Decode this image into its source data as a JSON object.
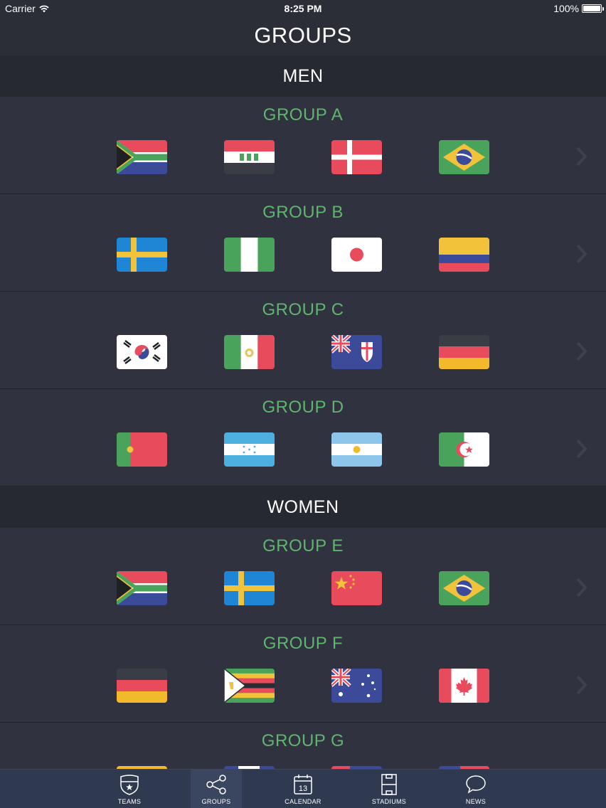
{
  "status_bar": {
    "carrier": "Carrier",
    "time": "8:25 PM",
    "battery": "100%"
  },
  "nav": {
    "title": "GROUPS"
  },
  "sections": [
    {
      "title": "MEN",
      "groups": [
        {
          "name": "GROUP A",
          "flags": [
            "south-africa-flag",
            "iraq-flag",
            "denmark-flag",
            "brazil-flag"
          ]
        },
        {
          "name": "GROUP B",
          "flags": [
            "sweden-flag",
            "nigeria-flag",
            "japan-flag",
            "colombia-flag"
          ]
        },
        {
          "name": "GROUP C",
          "flags": [
            "south-korea-flag",
            "mexico-flag",
            "fiji-flag",
            "germany-flag"
          ]
        },
        {
          "name": "GROUP D",
          "flags": [
            "portugal-flag",
            "honduras-flag",
            "argentina-flag",
            "algeria-flag"
          ]
        }
      ]
    },
    {
      "title": "WOMEN",
      "groups": [
        {
          "name": "GROUP E",
          "flags": [
            "south-africa-flag",
            "sweden-flag",
            "china-flag",
            "brazil-flag"
          ]
        },
        {
          "name": "GROUP F",
          "flags": [
            "germany-flag",
            "zimbabwe-flag",
            "australia-flag",
            "canada-flag"
          ]
        },
        {
          "name": "GROUP G",
          "flags": [
            "partial-flag",
            "partial-flag",
            "partial-flag",
            "partial-flag"
          ]
        }
      ]
    }
  ],
  "tabs": [
    {
      "label": "TEAMS",
      "icon": "badge-icon",
      "active": false
    },
    {
      "label": "GROUPS",
      "icon": "share-nodes-icon",
      "active": true
    },
    {
      "label": "CALENDAR",
      "icon": "calendar-icon",
      "calendar_day": "13",
      "active": false
    },
    {
      "label": "STADIUMS",
      "icon": "pitch-icon",
      "active": false
    },
    {
      "label": "NEWS",
      "icon": "speech-bubble-icon",
      "active": false
    }
  ],
  "colors": {
    "group_title": "#5fb56e",
    "row_bg": "#30333f",
    "section_bg": "#262932",
    "tab_bar_bg": "#2f3a50"
  }
}
